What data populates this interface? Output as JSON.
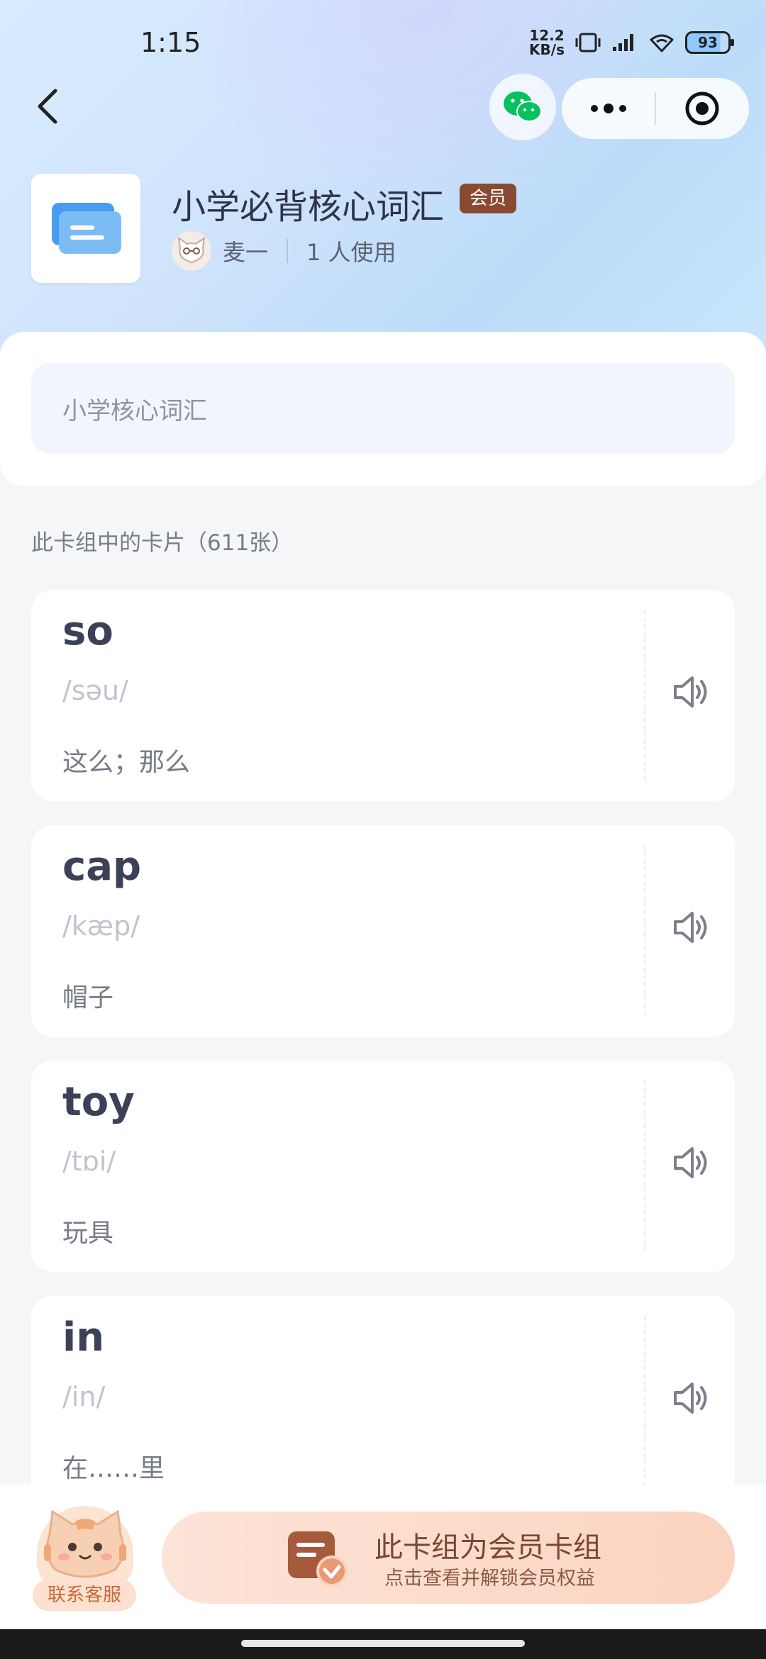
{
  "status_bar": {
    "time": "1:15",
    "net_speed_value": "12.2",
    "net_speed_unit": "KB/s",
    "battery": "93"
  },
  "deck": {
    "title": "小学必背核心词汇",
    "badge": "会员",
    "author": "麦一",
    "usage": "1 人使用",
    "description": "小学核心词汇"
  },
  "cards_section": {
    "label": "此卡组中的卡片（611张）"
  },
  "cards": [
    {
      "word": "so",
      "phonetic": "/səu/",
      "meaning": "这么；那么"
    },
    {
      "word": "cap",
      "phonetic": "/kæp/",
      "meaning": "帽子"
    },
    {
      "word": "toy",
      "phonetic": "/tɒi/",
      "meaning": "玩具"
    },
    {
      "word": "in",
      "phonetic": "/in/",
      "meaning": "在……里"
    }
  ],
  "bottom": {
    "service_label": "联系客服",
    "banner_title": "此卡组为会员卡组",
    "banner_subtitle": "点击查看并解锁会员权益"
  },
  "colors": {
    "badge": "#8a4a32",
    "wechat": "#07c160",
    "banner": "#fbd3c0"
  },
  "icons": [
    "back-arrow-icon",
    "wechat-icon",
    "more-dots-icon",
    "target-close-icon",
    "deck-cover-icon",
    "speaker-icon",
    "member-card-icon"
  ]
}
